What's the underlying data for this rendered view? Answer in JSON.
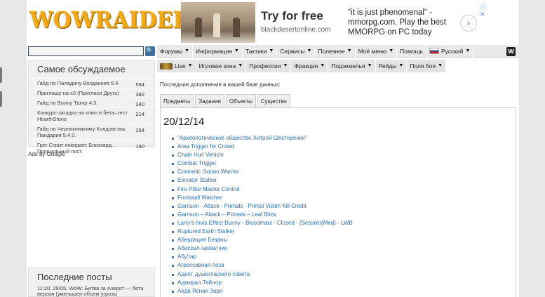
{
  "logo": "WOWRAIDER",
  "ad": {
    "title": "Try for free",
    "url": "blackdesertonline.com",
    "text": "\"it is just phenomenal\" - mmorpg.com. Play the best MMORPG on PC today",
    "arrow": "›",
    "close": "ⓘ ✕"
  },
  "search": {
    "button": "🔍"
  },
  "menu": [
    "Форумы",
    "Информация",
    "Тактики",
    "Сервисы",
    "Полезное",
    "Моё меню",
    "Помощь",
    "Русский"
  ],
  "w_button": "W",
  "submenu": [
    "Live",
    "Игровая зона",
    "Профессии",
    "Фракция",
    "Подземелья",
    "Рейды",
    "Поля боя"
  ],
  "sidebar": {
    "title": "Самое обсуждаемое",
    "items": [
      {
        "text": "Гайд по Паладину Возданния 5.4",
        "count": "594"
      },
      {
        "text": "Приглашу на х3 (Пригласи Друга)",
        "count": "382"
      },
      {
        "text": "Гайд по Воину Танку 4.3.",
        "count": "340"
      },
      {
        "text": "Конкурс-загадка на ключ в бета–тест HearthStone",
        "count": "214"
      },
      {
        "text": "Гайд по Чернокнижнику Колдовства. Пандария 5.4.0.",
        "count": "254"
      },
      {
        "text": "Грег Стрит покидает Близзард. Прощальный пост.",
        "count": "190"
      }
    ]
  },
  "ads_by_google": "Ads by Google",
  "latest_posts": {
    "title": "Последние посты",
    "post": "11:20, 29/05; WoW: Битва за Азерот — бета версия (уменьшен объем угрозы"
  },
  "content": {
    "heading": "Последние дополнения в нашей базе данных:",
    "tabs": [
      "Предметы",
      "Задания",
      "Объекты",
      "Существо"
    ],
    "date": "20/12/14",
    "items": [
      "\"Археологическое общество Хитрой Шестеренки\"",
      "Area Trigger for Crowd",
      "Chain Hurl Vehicle",
      "Combat Trigger",
      "Cosmetic Gorian Warrior",
      "Elevator Stalker",
      "Fire Pillar Master Control",
      "Frostwall Watcher",
      "Garrison - Attack - Primals - Primal Victim Kill Credit",
      "Garrison – Attack – Primals – Leaf Blow",
      "Larry's Invis Effect Bunny - Bloodmaul - Closed - (Sessile)(Med) - LWB",
      "Ruptured Earth Stalker",
      "Аберрация Бездны",
      "Абиссал-захватчик",
      "Абу'гар",
      "Агрессивная лоза",
      "Адепт душегласного совета",
      "Адмирал Тейлор",
      "Аеда Ясная Заря"
    ]
  }
}
